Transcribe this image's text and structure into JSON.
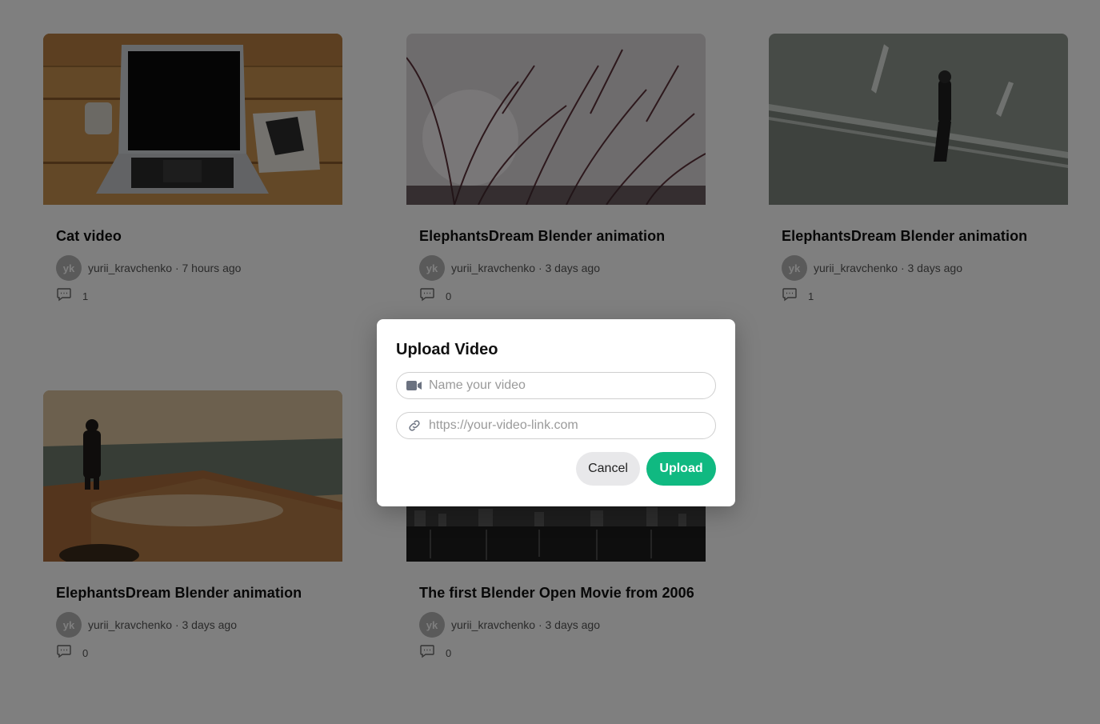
{
  "videos": [
    {
      "title": "Cat video",
      "avatar": "yk",
      "meta": "yurii_kravchenko · 7 hours ago",
      "comments": "1",
      "thumb": "laptop-on-desk"
    },
    {
      "title": "ElephantsDream Blender animation",
      "avatar": "yk",
      "meta": "yurii_kravchenko · 3 days ago",
      "comments": "0",
      "thumb": "tree-branches"
    },
    {
      "title": "ElephantsDream Blender animation",
      "avatar": "yk",
      "meta": "yurii_kravchenko · 3 days ago",
      "comments": "1",
      "thumb": "man-walking-road"
    },
    {
      "title": "ElephantsDream Blender animation",
      "avatar": "yk",
      "meta": "yurii_kravchenko · 3 days ago",
      "comments": "0",
      "thumb": "man-by-sea"
    },
    {
      "title": "The first Blender Open Movie from 2006",
      "avatar": "yk",
      "meta": "yurii_kravchenko · 3 days ago",
      "comments": "0",
      "thumb": "city-night"
    }
  ],
  "modal": {
    "title": "Upload Video",
    "name_placeholder": "Name your video",
    "name_icon": "video-camera-icon",
    "link_placeholder": "https://your-video-link.com",
    "link_icon": "link-icon",
    "cancel_label": "Cancel",
    "upload_label": "Upload"
  },
  "colors": {
    "accent": "#10b981",
    "overlay": "rgba(0,0,0,0.5)"
  }
}
